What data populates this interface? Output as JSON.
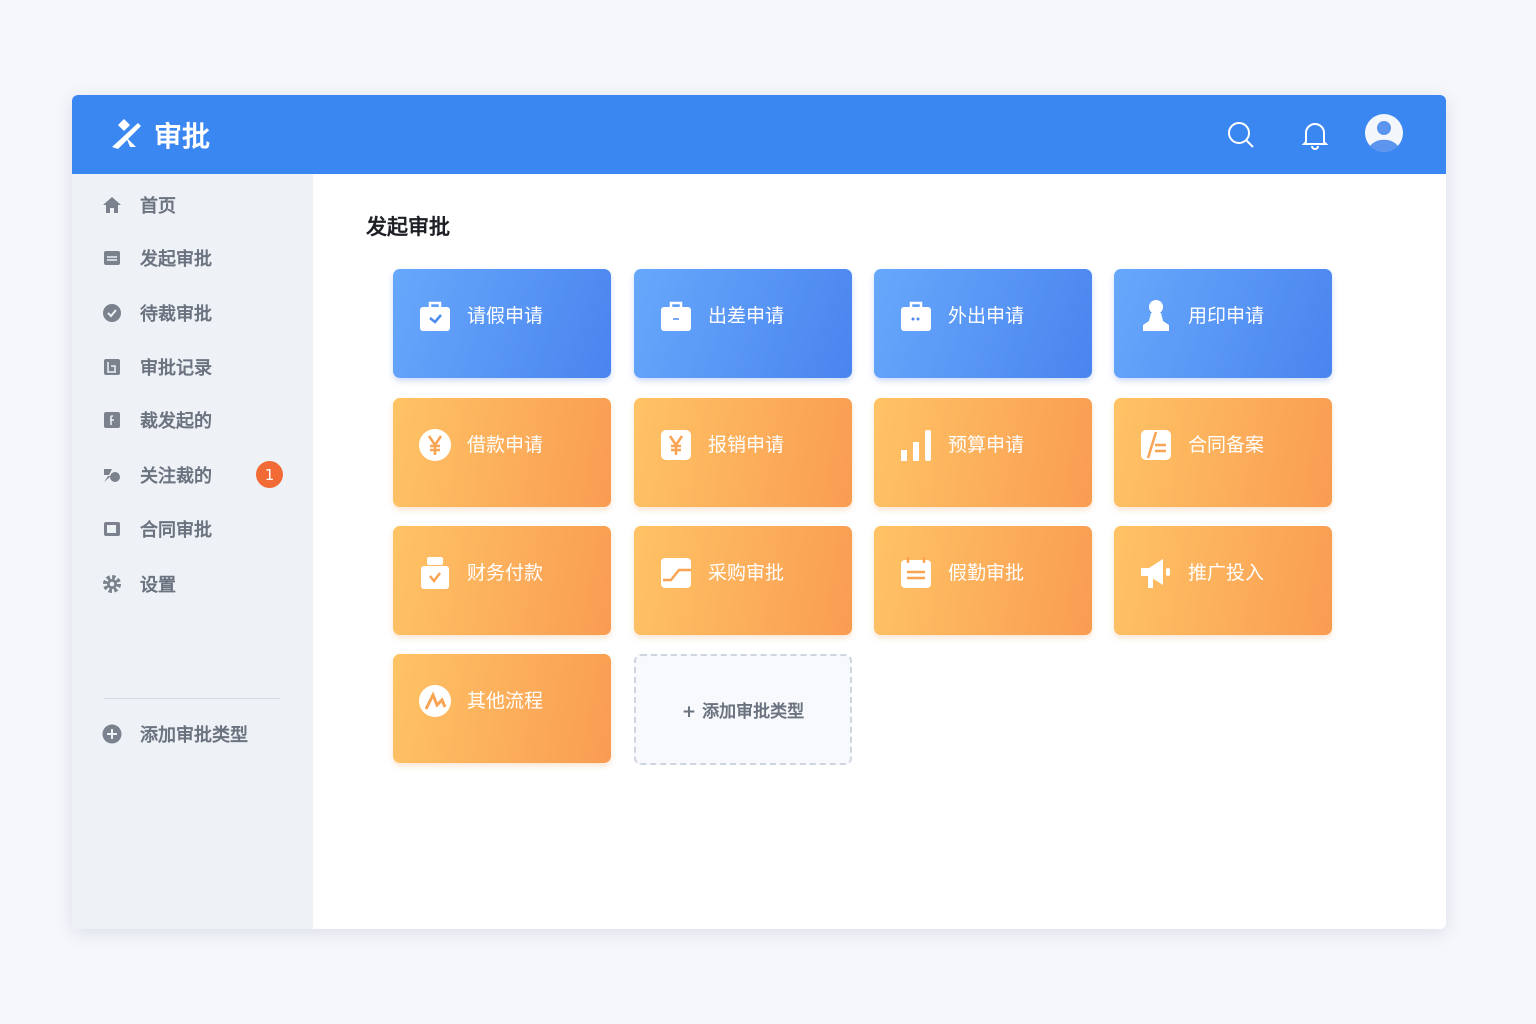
{
  "header": {
    "brand": "审批",
    "icons": [
      "search-icon",
      "bell-icon",
      "avatar-icon"
    ]
  },
  "sidebar": {
    "items": [
      {
        "label": "首页",
        "icon": "home-icon"
      },
      {
        "label": "发起审批",
        "icon": "form-icon"
      },
      {
        "label": "待裁审批",
        "icon": "check-circle-icon"
      },
      {
        "label": "审批记录",
        "icon": "record-icon"
      },
      {
        "label": "裁发起的",
        "icon": "file-icon"
      },
      {
        "label": "关注裁的",
        "icon": "follow-icon",
        "badge": "1"
      },
      {
        "label": "合同审批",
        "icon": "contract-icon"
      },
      {
        "label": "设置",
        "icon": "gear-icon"
      }
    ],
    "add_label": "添加审批类型"
  },
  "main": {
    "title": "发起审批",
    "cards": [
      {
        "label": "请假申请",
        "color": "blue",
        "icon": "briefcase-check-icon"
      },
      {
        "label": "出差申请",
        "color": "blue",
        "icon": "briefcase-icon"
      },
      {
        "label": "外出申请",
        "color": "blue",
        "icon": "bag-icon"
      },
      {
        "label": "用印申请",
        "color": "blue",
        "icon": "person-icon"
      },
      {
        "label": "借款申请",
        "color": "orange",
        "icon": "yen-circle-icon"
      },
      {
        "label": "报销申请",
        "color": "orange",
        "icon": "yen-doc-icon"
      },
      {
        "label": "预算申请",
        "color": "orange",
        "icon": "bar-chart-icon"
      },
      {
        "label": "合同备案",
        "color": "orange",
        "icon": "contract-pen-icon"
      },
      {
        "label": "财务付款",
        "color": "orange",
        "icon": "payment-icon"
      },
      {
        "label": "采购审批",
        "color": "orange",
        "icon": "trend-icon"
      },
      {
        "label": "假勤审批",
        "color": "orange",
        "icon": "calendar-icon"
      },
      {
        "label": "推广投入",
        "color": "orange",
        "icon": "megaphone-icon"
      },
      {
        "label": "其他流程",
        "color": "orange",
        "icon": "flow-icon"
      }
    ],
    "add_card_label": "+ 添加审批类型"
  },
  "colors": {
    "header": "#3b87f2",
    "badge": "#f26b36"
  }
}
